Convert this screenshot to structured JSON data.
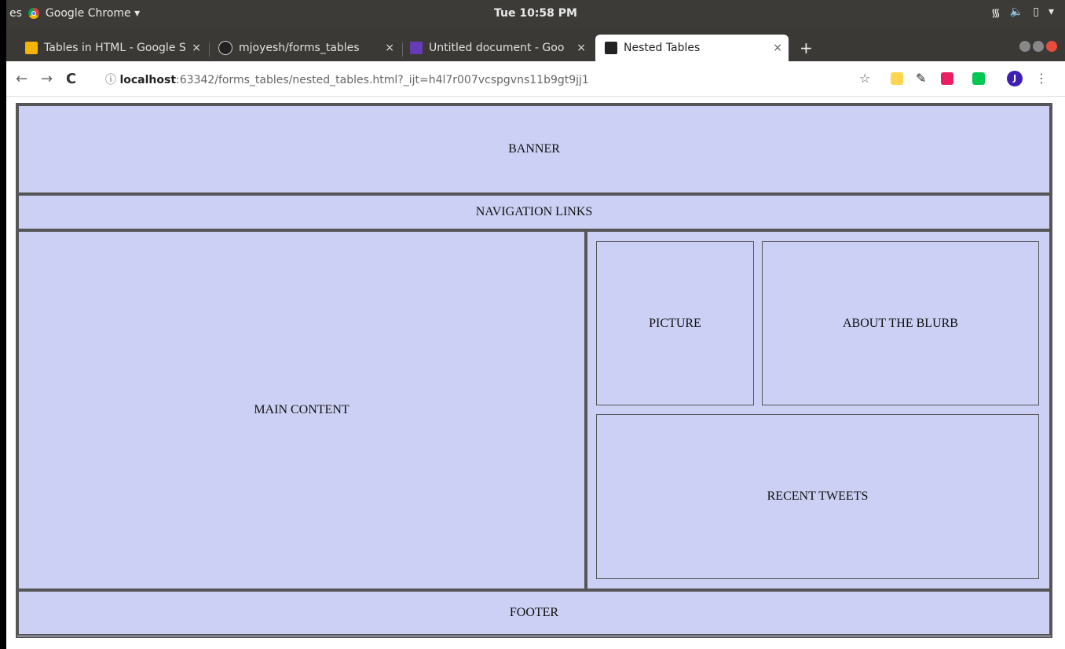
{
  "os": {
    "app_menu": "Google Chrome ▾",
    "clipped_left": "es",
    "clock": "Tue 10:58 PM",
    "tray": [
      "wifi-icon",
      "volume-icon",
      "battery-icon",
      "power-menu-icon"
    ]
  },
  "tabs": [
    {
      "label": "Tables in HTML - Google S",
      "favicon_color": "#f4b400",
      "active": false
    },
    {
      "label": "mjoyesh/forms_tables",
      "favicon_color": "#222222",
      "active": false
    },
    {
      "label": "Untitled document - Goo",
      "favicon_color": "#673ab7",
      "active": false
    },
    {
      "label": "Nested Tables",
      "favicon_color": "#222222",
      "active": true
    }
  ],
  "close_glyph": "×",
  "new_tab": "+",
  "address": {
    "host": "localhost",
    "rest": ":63342/forms_tables/nested_tables.html?_ijt=h4l7r007vcspgvns11b9gt9jj1",
    "info_icon": "ⓘ"
  },
  "profile_initial": "J",
  "layout_cells": {
    "banner": "BANNER",
    "nav": "NAVIGATION LINKS",
    "main": "MAIN CONTENT",
    "picture": "PICTURE",
    "about": "ABOUT THE BLURB",
    "tweets": "RECENT TWEETS",
    "footer": "FOOTER"
  },
  "colors": {
    "cell_bg": "#cbd0f4",
    "border": "#555555",
    "panel": "#3c3b37"
  }
}
